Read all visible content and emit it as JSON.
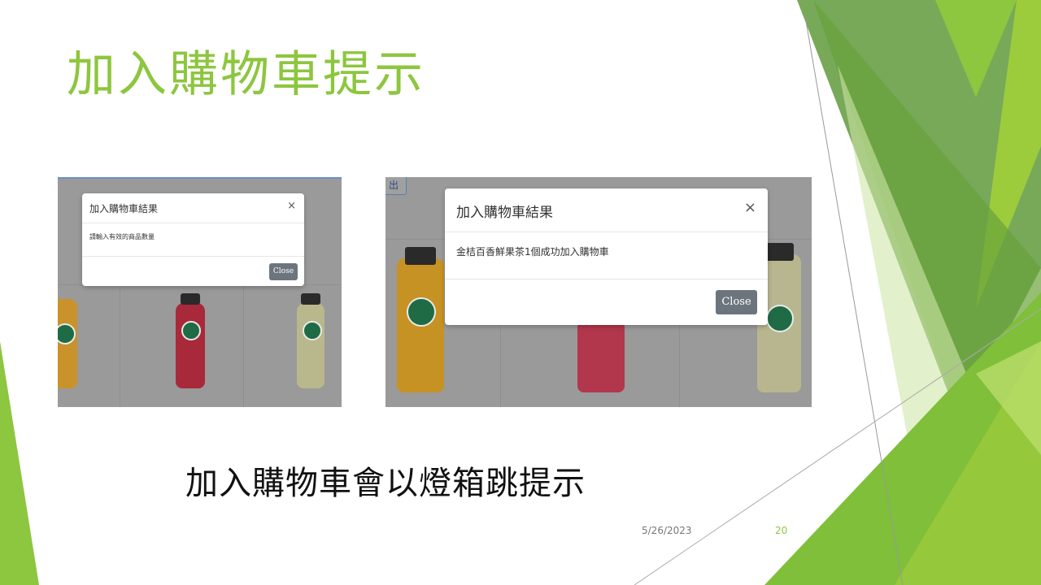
{
  "slide": {
    "title": "加入購物車提示",
    "subtitle": "加入購物車會以燈箱跳提示",
    "date": "5/26/2023",
    "page_number": "20"
  },
  "screenshot_left": {
    "modal_title": "加入購物車結果",
    "close_x": "×",
    "message": "請輸入有效的商品數量",
    "close_button": "Close"
  },
  "screenshot_right": {
    "logout_fragment": "出",
    "modal_title": "加入購物車結果",
    "close_x": "×",
    "message": "金桔百香鮮果茶1個成功加入購物車",
    "close_button": "Close"
  },
  "colors": {
    "accent_green": "#8dc63f",
    "button_gray": "#6c757d",
    "overlay_gray": "#8a8a8a"
  }
}
